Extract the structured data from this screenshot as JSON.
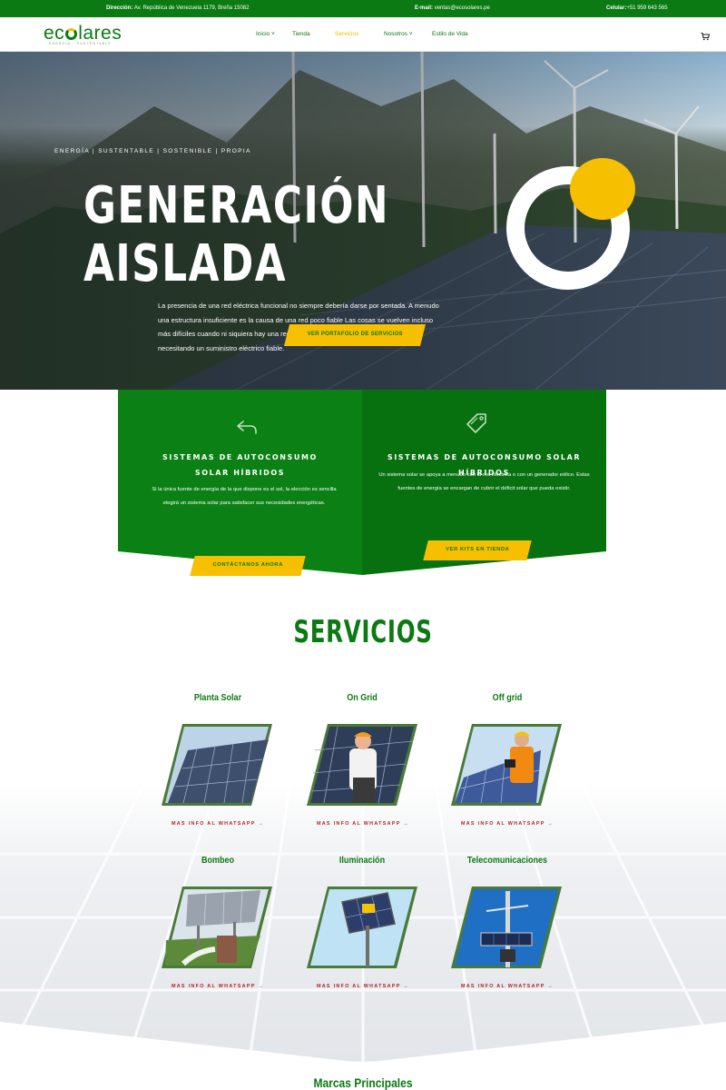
{
  "topbar": {
    "address_label": "Dirección:",
    "address": "Av. República de Venezuela 1179, Breña 15082",
    "email_label": "E-mail:",
    "email": "ventas@ecosolares.pe",
    "phone_label": "Celular:",
    "phone": "+51 959 643 565"
  },
  "header": {
    "logo": "ecsolares",
    "logo_prefix": "ec",
    "logo_suffix": "lares",
    "logo_sub": "ENERGÍA · SUSTENTABLE",
    "nav": [
      {
        "label": "Inicio"
      },
      {
        "label": "Tienda"
      },
      {
        "label": "Servicios"
      },
      {
        "label": "Nosotros"
      },
      {
        "label": "Estilo de Vida"
      }
    ]
  },
  "hero": {
    "tagline": "ENERGÍA | SUSTENTABLE | SOSTENIBLE | PROPIA",
    "title_line1": "GENERACIÓN",
    "title_line2": "AISLADA",
    "description": "La presencia de una red eléctrica funcional no siempre debería darse por sentada. A menudo una estructura insuficiente es la causa de una red poco fiable Las cosas se vuelven incluso más difíciles cuando ni siquiera hay una red eléctrica A pesar de todo, usted sigue necesitando un suministro eléctrico fiable.",
    "button": "VER PORTAFOLIO DE SERVICIOS"
  },
  "cards": {
    "left": {
      "icon": "reply-arrow-icon",
      "title_line1": "SISTEMAS DE AUTOCONSUMO",
      "title_line2": "SOLAR HÍBRIDOS",
      "text": "Si la única fuente de energía de la que dispone es el sol, la elección es sencilla elegirá un sistema solar para satisfacer sus necesidades energéticas.",
      "button": "CONTÁCTANOS AHORA"
    },
    "right": {
      "icon": "tag-icon",
      "title": "SISTEMAS DE AUTOCONSUMO SOLAR HÍBRIDOS",
      "text": "Un sistema solar se apoya a menudo con la red eléctrica o con un generador eólico. Estas fuentes de energía se encargan de cubrir el déficit solar que pueda existir.",
      "button": "VER KITS EN TIENDA"
    }
  },
  "services": {
    "title": "SERVICIOS",
    "link_label": "MAS INFO AL WHATSAPP →",
    "items": [
      {
        "title": "Planta Solar",
        "image": "solar-plant-image"
      },
      {
        "title": "On Grid",
        "image": "technician-panels-image"
      },
      {
        "title": "Off grid",
        "image": "engineer-tablet-image"
      },
      {
        "title": "Bombeo",
        "image": "water-pump-image"
      },
      {
        "title": "Iluminación",
        "image": "solar-streetlight-image"
      },
      {
        "title": "Telecomunicaciones",
        "image": "telecom-pole-image"
      }
    ]
  },
  "brands": {
    "title": "Marcas Principales"
  },
  "colors": {
    "brand_green": "#0b7a12",
    "accent_yellow": "#f6bf00",
    "link_red": "#b4202a"
  }
}
